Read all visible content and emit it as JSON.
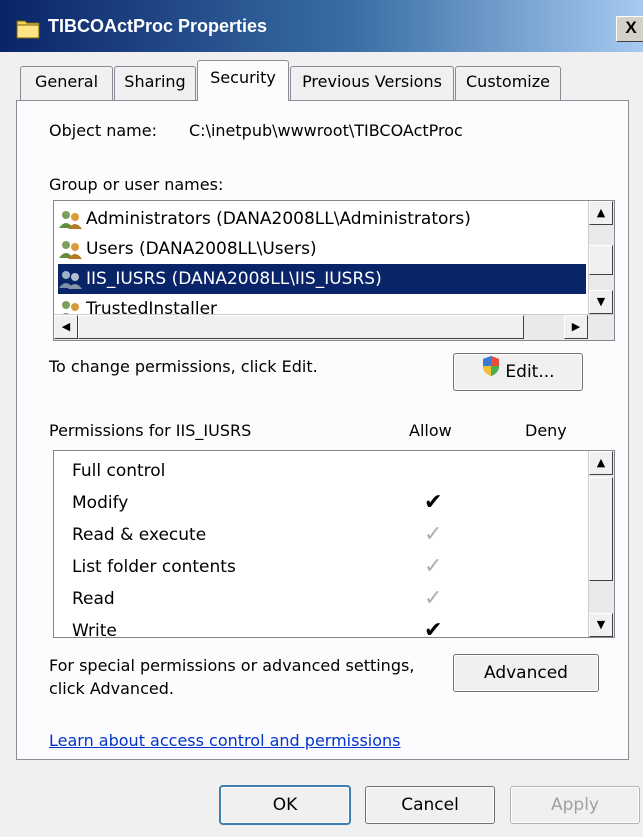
{
  "window": {
    "title": "TIBCOActProc Properties",
    "close_label": "X"
  },
  "tabs": [
    {
      "label": "General",
      "active": false
    },
    {
      "label": "Sharing",
      "active": false
    },
    {
      "label": "Security",
      "active": true
    },
    {
      "label": "Previous Versions",
      "active": false
    },
    {
      "label": "Customize",
      "active": false
    }
  ],
  "security": {
    "object_name_label": "Object name:",
    "object_name_value": "C:\\inetpub\\wwwroot\\TIBCOActProc",
    "group_label": "Group or user names:",
    "users": [
      {
        "name": "Administrators (DANA2008LL\\Administrators)",
        "selected": false
      },
      {
        "name": "Users (DANA2008LL\\Users)",
        "selected": false
      },
      {
        "name": "IIS_IUSRS (DANA2008LL\\IIS_IUSRS)",
        "selected": true
      },
      {
        "name": "TrustedInstaller",
        "selected": false
      }
    ],
    "change_hint": "To change permissions, click Edit.",
    "edit_label": "Edit...",
    "permissions_header": "Permissions for IIS_IUSRS",
    "allow_header": "Allow",
    "deny_header": "Deny",
    "permissions": [
      {
        "name": "Full control",
        "allow": "none",
        "deny": "none"
      },
      {
        "name": "Modify",
        "allow": "checked",
        "deny": "none"
      },
      {
        "name": "Read & execute",
        "allow": "inherited",
        "deny": "none"
      },
      {
        "name": "List folder contents",
        "allow": "inherited",
        "deny": "none"
      },
      {
        "name": "Read",
        "allow": "inherited",
        "deny": "none"
      },
      {
        "name": "Write",
        "allow": "checked",
        "deny": "none"
      }
    ],
    "special_hint_line1": "For special permissions or advanced settings,",
    "special_hint_line2": "click Advanced.",
    "advanced_label": "Advanced",
    "learn_link": "Learn about access control and permissions"
  },
  "footer": {
    "ok_label": "OK",
    "cancel_label": "Cancel",
    "apply_label": "Apply",
    "apply_enabled": false
  },
  "icons": {
    "folder": "folder-icon",
    "user": "user-group-icon",
    "shield": "uac-shield-icon",
    "check": "checkmark-icon"
  },
  "colors": {
    "selection": "#0a246a",
    "link": "#0033cc",
    "titlebar_start": "#0a246a",
    "titlebar_end": "#a6caf0"
  }
}
